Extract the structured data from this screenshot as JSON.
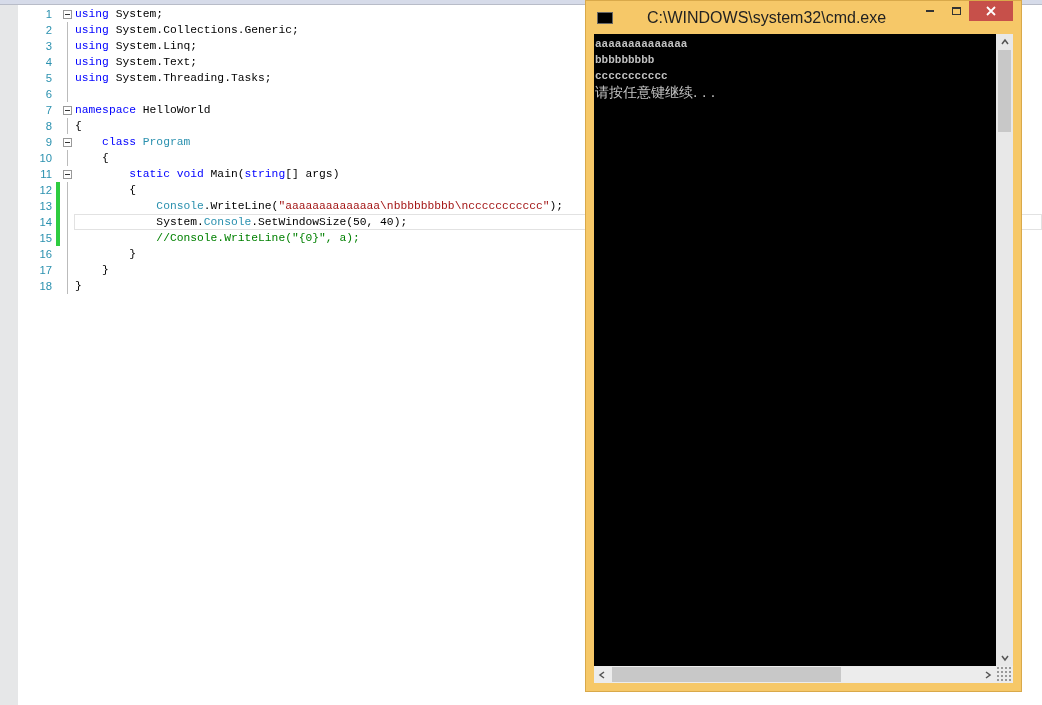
{
  "editor": {
    "lines": [
      {
        "number": "1",
        "foldable": true,
        "changed": false,
        "current": false,
        "tokens": [
          {
            "kind": "keyword",
            "text": "using"
          },
          {
            "kind": "plain",
            "text": " System;"
          }
        ]
      },
      {
        "number": "2",
        "foldable": false,
        "changed": false,
        "current": false,
        "tokens": [
          {
            "kind": "keyword",
            "text": "using"
          },
          {
            "kind": "plain",
            "text": " System.Collections.Generic;"
          }
        ]
      },
      {
        "number": "3",
        "foldable": false,
        "changed": false,
        "current": false,
        "tokens": [
          {
            "kind": "keyword",
            "text": "using"
          },
          {
            "kind": "plain",
            "text": " System.Linq;"
          }
        ]
      },
      {
        "number": "4",
        "foldable": false,
        "changed": false,
        "current": false,
        "tokens": [
          {
            "kind": "keyword",
            "text": "using"
          },
          {
            "kind": "plain",
            "text": " System.Text;"
          }
        ]
      },
      {
        "number": "5",
        "foldable": false,
        "changed": false,
        "current": false,
        "tokens": [
          {
            "kind": "keyword",
            "text": "using"
          },
          {
            "kind": "plain",
            "text": " System.Threading.Tasks;"
          }
        ]
      },
      {
        "number": "6",
        "foldable": false,
        "changed": false,
        "current": false
      },
      {
        "number": "7",
        "foldable": true,
        "changed": false,
        "current": false,
        "tokens": [
          {
            "kind": "keyword",
            "text": "namespace"
          },
          {
            "kind": "plain",
            "text": " HelloWorld"
          }
        ]
      },
      {
        "number": "8",
        "foldable": false,
        "changed": false,
        "current": false,
        "tokens": [
          {
            "kind": "plain",
            "text": "{"
          }
        ]
      },
      {
        "number": "9",
        "foldable": true,
        "changed": false,
        "current": false,
        "tokens": [
          {
            "kind": "keyword",
            "text": "    class"
          },
          {
            "kind": "type",
            "text": " Program"
          }
        ]
      },
      {
        "number": "10",
        "foldable": false,
        "changed": false,
        "current": false,
        "tokens": [
          {
            "kind": "plain",
            "text": "    {"
          }
        ]
      },
      {
        "number": "11",
        "foldable": true,
        "changed": false,
        "current": false,
        "tokens": [
          {
            "kind": "keyword",
            "text": "        static void"
          },
          {
            "kind": "plain",
            "text": " Main("
          },
          {
            "kind": "keyword",
            "text": "string"
          },
          {
            "kind": "plain",
            "text": "[] args)"
          }
        ]
      },
      {
        "number": "12",
        "foldable": false,
        "changed": true,
        "current": false,
        "tokens": [
          {
            "kind": "plain",
            "text": "        {"
          }
        ]
      },
      {
        "number": "13",
        "foldable": false,
        "changed": true,
        "current": false,
        "tokens": [
          {
            "kind": "type",
            "text": "            Console"
          },
          {
            "kind": "plain",
            "text": ".WriteLine("
          },
          {
            "kind": "string",
            "text": "\"aaaaaaaaaaaaaa\\nbbbbbbbbb\\nccccccccccc\""
          },
          {
            "kind": "plain",
            "text": ");"
          }
        ]
      },
      {
        "number": "14",
        "foldable": false,
        "changed": true,
        "current": true,
        "tokens": [
          {
            "kind": "plain",
            "text": "            System."
          },
          {
            "kind": "type",
            "text": "Console"
          },
          {
            "kind": "plain",
            "text": ".SetWindowSize(50, 40);"
          }
        ]
      },
      {
        "number": "15",
        "foldable": false,
        "changed": true,
        "current": false,
        "tokens": [
          {
            "kind": "comment",
            "text": "            //Console.WriteLine(\"{0}\", a);"
          }
        ]
      },
      {
        "number": "16",
        "foldable": false,
        "changed": false,
        "current": false,
        "tokens": [
          {
            "kind": "plain",
            "text": "        }"
          }
        ]
      },
      {
        "number": "17",
        "foldable": false,
        "changed": false,
        "current": false,
        "tokens": [
          {
            "kind": "plain",
            "text": "    }"
          }
        ]
      },
      {
        "number": "18",
        "foldable": false,
        "changed": false,
        "current": false,
        "tokens": [
          {
            "kind": "plain",
            "text": "}"
          }
        ]
      }
    ]
  },
  "console_window": {
    "title": "C:\\WINDOWS\\system32\\cmd.exe",
    "output": [
      {
        "kind": "latin",
        "text": "aaaaaaaaaaaaaa"
      },
      {
        "kind": "latin",
        "text": "bbbbbbbbb"
      },
      {
        "kind": "latin",
        "text": "ccccccccccc"
      },
      {
        "kind": "cjk",
        "text": "请按任意键继续. . ."
      }
    ]
  }
}
